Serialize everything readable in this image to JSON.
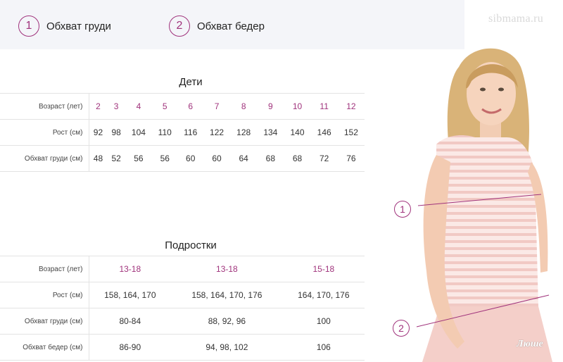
{
  "legend": [
    {
      "num": "1",
      "label": "Обхват груди"
    },
    {
      "num": "2",
      "label": "Обхват бедер"
    }
  ],
  "watermark": "sibmama.ru",
  "kids": {
    "title": "Дети",
    "rows": [
      {
        "label": "Возраст (лет)",
        "values": [
          "2",
          "3",
          "4",
          "5",
          "6",
          "7",
          "8",
          "9",
          "10",
          "11",
          "12"
        ]
      },
      {
        "label": "Рост (см)",
        "values": [
          "92",
          "98",
          "104",
          "110",
          "116",
          "122",
          "128",
          "134",
          "140",
          "146",
          "152"
        ]
      },
      {
        "label": "Обхват груди (см)",
        "values": [
          "48",
          "52",
          "56",
          "56",
          "60",
          "60",
          "64",
          "68",
          "68",
          "72",
          "76"
        ]
      }
    ]
  },
  "teens": {
    "title": "Подростки",
    "rows": [
      {
        "label": "Возраст (лет)",
        "values": [
          "13-18",
          "13-18",
          "15-18"
        ]
      },
      {
        "label": "Рост (см)",
        "values": [
          "158, 164, 170",
          "158, 164, 170, 176",
          "164, 170, 176"
        ]
      },
      {
        "label": "Обхват груди (см)",
        "values": [
          "80-84",
          "88, 92, 96",
          "100"
        ]
      },
      {
        "label": "Обхват бедер (см)",
        "values": [
          "86-90",
          "94, 98, 102",
          "106"
        ]
      }
    ]
  },
  "photo": {
    "marks": [
      "1",
      "2"
    ],
    "brand": "Люше"
  },
  "colors": {
    "accent": "#a0337c",
    "band": "#f4f5f9"
  }
}
